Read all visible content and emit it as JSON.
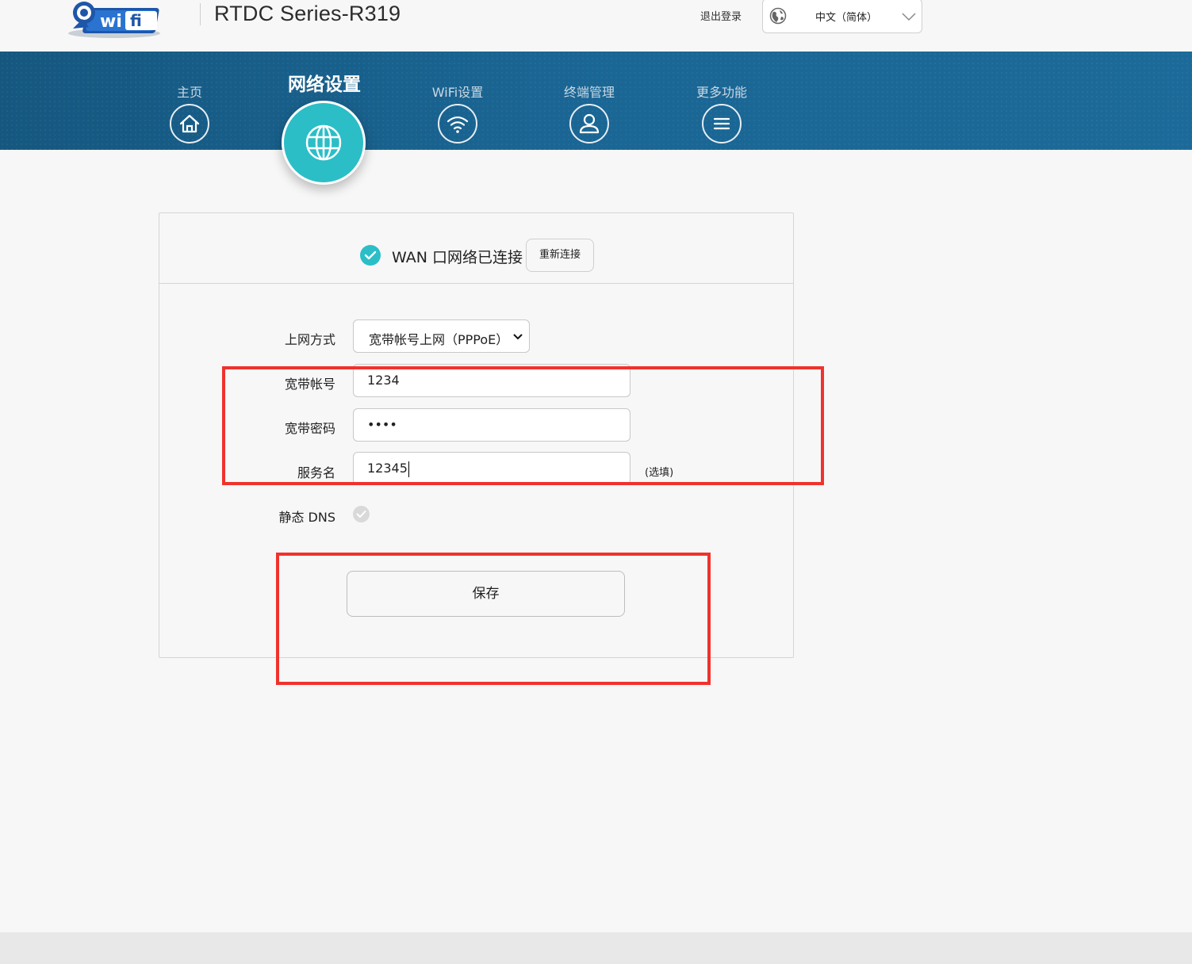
{
  "header": {
    "product_title": "RTDC Series-R319",
    "logout_label": "退出登录",
    "language": "中文（简体）"
  },
  "nav": {
    "items": [
      {
        "label": "主页",
        "icon": "home-icon"
      },
      {
        "label": "网络设置",
        "icon": "globe-icon",
        "active": true
      },
      {
        "label": "WiFi设置",
        "icon": "wifi-icon"
      },
      {
        "label": "终端管理",
        "icon": "user-icon"
      },
      {
        "label": "更多功能",
        "icon": "menu-icon"
      }
    ]
  },
  "status": {
    "text": "WAN 口网络已连接",
    "reconnect_label": "重新连接"
  },
  "form": {
    "mode_label": "上网方式",
    "mode_value": "宽带帐号上网（PPPoE）",
    "account_label": "宽带帐号",
    "account_value": "1234",
    "password_label": "宽带密码",
    "password_value": "••••",
    "service_label": "服务名",
    "service_value": "12345",
    "service_note": "(选填)",
    "dns_label": "静态 DNS",
    "save_label": "保存"
  },
  "colors": {
    "nav_bg": "#1a6593",
    "accent": "#2bbec7",
    "annotation": "#f0322d"
  }
}
